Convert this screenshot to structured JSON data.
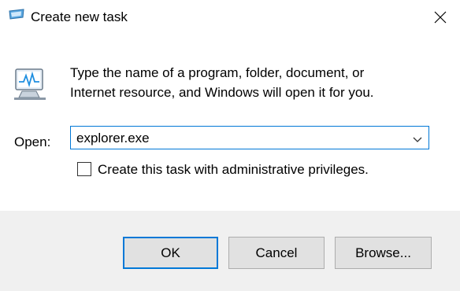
{
  "window": {
    "title": "Create new task",
    "title_icon": "run-icon",
    "close_icon": "close-icon"
  },
  "content": {
    "icon": "run-program-icon",
    "description_line1": "Type the name of a program, folder, document, or",
    "description_line2": "Internet resource, and Windows will open it for you.",
    "open_label": "Open:",
    "open_value": "explorer.exe",
    "dropdown_icon": "chevron-down-icon",
    "admin_checkbox_label": "Create this task with administrative privileges.",
    "admin_checked": false
  },
  "buttons": {
    "ok": "OK",
    "cancel": "Cancel",
    "browse": "Browse..."
  },
  "colors": {
    "accent": "#0078d7",
    "footer_bg": "#f0f0f0",
    "button_bg": "#e1e1e1"
  }
}
